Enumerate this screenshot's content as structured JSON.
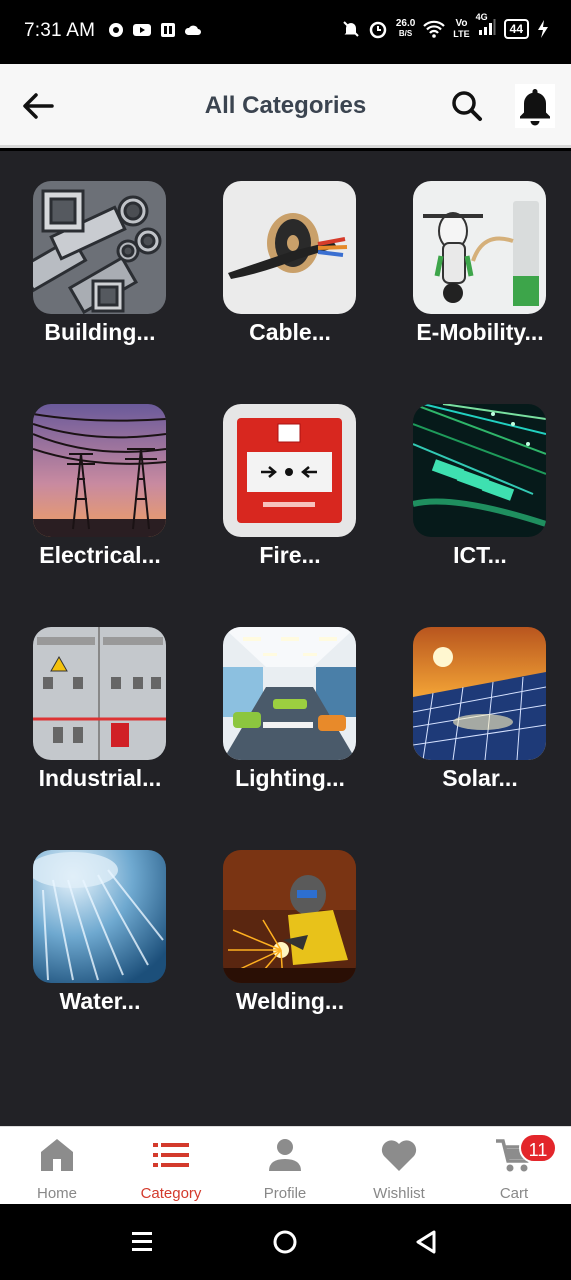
{
  "status_bar": {
    "time": "7:31 AM",
    "speed_value": "26.0",
    "speed_unit": "B/S",
    "network_top": "Vo",
    "network_bottom": "LTE",
    "network_gen": "4G",
    "battery": "44",
    "icons": [
      "chrome-icon",
      "youtube-icon",
      "paytm-icon",
      "cloud-icon",
      "mute-icon",
      "alarm-icon",
      "wifi-icon",
      "signal-icon",
      "battery-icon",
      "charging-icon"
    ]
  },
  "header": {
    "title": "All Categories",
    "back_icon": "arrow-left-icon",
    "search_icon": "search-icon",
    "notification_icon": "bell-icon"
  },
  "categories": [
    {
      "label": "Building...",
      "image": "steel-pipes"
    },
    {
      "label": "Cable...",
      "image": "cable-spool"
    },
    {
      "label": "E-Mobility...",
      "image": "electric-scooter"
    },
    {
      "label": "Electrical...",
      "image": "power-towers"
    },
    {
      "label": "Fire...",
      "image": "fire-alarm-call-point"
    },
    {
      "label": "ICT...",
      "image": "fiber-optic-cables"
    },
    {
      "label": "Industrial...",
      "image": "control-panel"
    },
    {
      "label": "Lighting...",
      "image": "lit-office-interior"
    },
    {
      "label": "Solar...",
      "image": "solar-panels"
    },
    {
      "label": "Water...",
      "image": "shower-water"
    },
    {
      "label": "Welding...",
      "image": "welder-sparks"
    }
  ],
  "bottom_nav": {
    "items": [
      {
        "label": "Home",
        "icon": "home-icon"
      },
      {
        "label": "Category",
        "icon": "list-icon"
      },
      {
        "label": "Profile",
        "icon": "person-icon"
      },
      {
        "label": "Wishlist",
        "icon": "heart-icon"
      },
      {
        "label": "Cart",
        "icon": "cart-icon"
      }
    ],
    "active": "Category",
    "cart_badge": "11"
  },
  "system_nav": {
    "icons": [
      "menu-icon",
      "home-circle-icon",
      "back-triangle-icon"
    ]
  },
  "colors": {
    "background": "#222226",
    "accent": "#d33a2c",
    "badge": "#e3262b",
    "title_text": "#3b4450"
  }
}
